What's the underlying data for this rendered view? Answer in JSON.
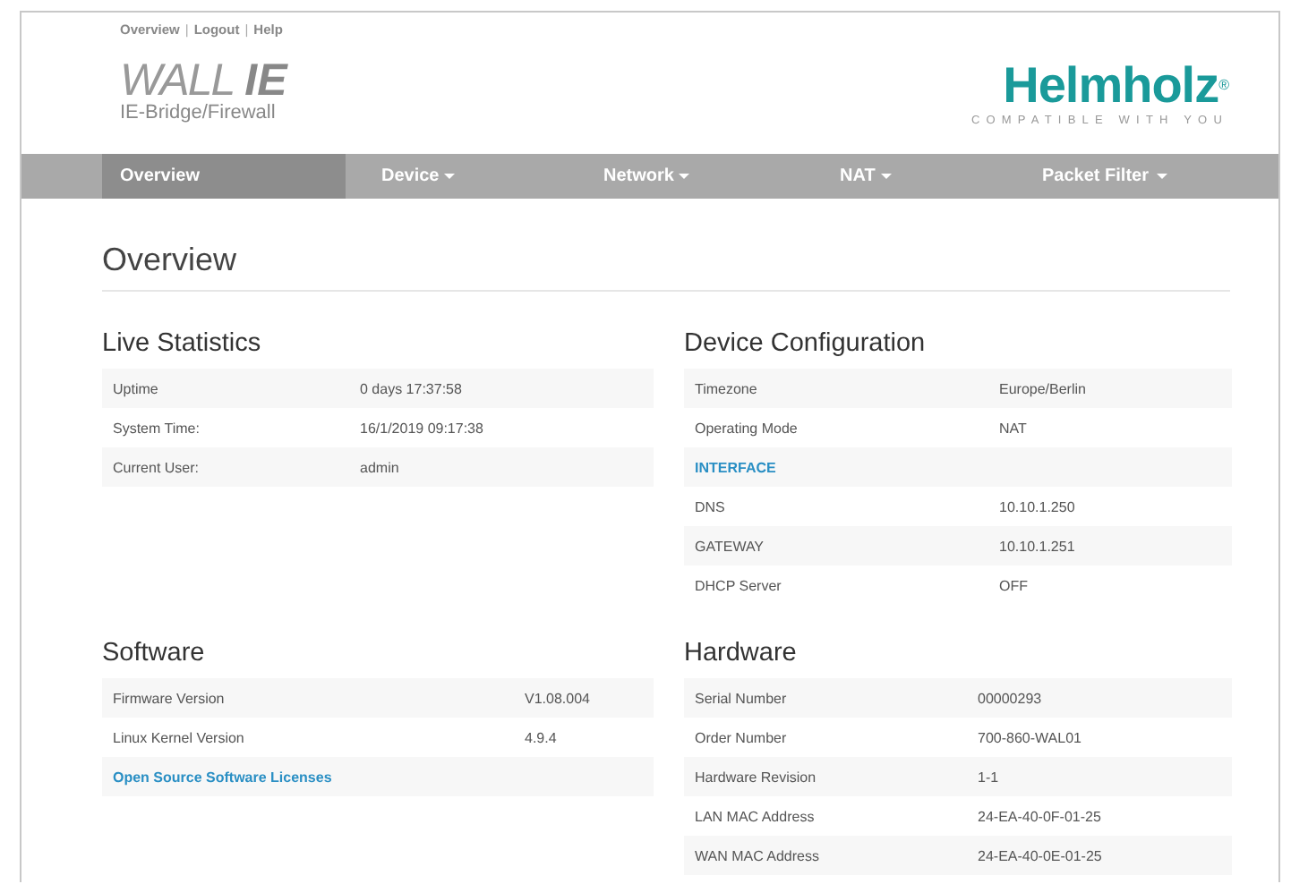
{
  "top_links": [
    {
      "label": "Overview"
    },
    {
      "label": "|",
      "kind": "separator"
    },
    {
      "label": "Logout"
    },
    {
      "label": "|",
      "kind": "separator"
    },
    {
      "label": "Help"
    }
  ],
  "product": {
    "name_light": "WALL",
    "name_bold": "IE",
    "subtitle": "IE-Bridge/Firewall"
  },
  "brand": {
    "name": "Helmholz$^{®}$",
    "tagline": "COMPATIBLE WITH YOU"
  },
  "nav": [
    {
      "label": "Overview",
      "selected": true,
      "dropdown": false
    },
    {
      "label": "Device",
      "selected": false,
      "dropdown": true
    },
    {
      "label": "Network",
      "selected": false,
      "dropdown": true
    },
    {
      "label": "NAT",
      "selected": false,
      "dropdown": true
    },
    {
      "label": "Packet Filter",
      "selected": false,
      "dropdown": true
    }
  ],
  "page_title": "Overview",
  "sections": [
    {
      "title": "Live Statistics",
      "rows": [
        {
          "kind": "pair",
          "label": "Uptime",
          "value": "0 days 17:37:58"
        },
        {
          "kind": "pair",
          "label": "System Time:",
          "value": "16/1/2019 09:17:38"
        },
        {
          "kind": "pair",
          "label": "Current User:",
          "value": "admin"
        }
      ]
    },
    {
      "title": "Device Configuration",
      "rows": [
        {
          "kind": "pair",
          "label": "Timezone",
          "value": "Europe/Berlin"
        },
        {
          "kind": "pair",
          "label": "Operating Mode",
          "value": "NAT"
        },
        {
          "kind": "heading",
          "label": "INTERFACE"
        },
        {
          "kind": "pair",
          "label": "DNS",
          "value": "10.10.1.250"
        },
        {
          "kind": "pair",
          "label": "GATEWAY",
          "value": "10.10.1.251"
        },
        {
          "kind": "pair",
          "label": "DHCP Server",
          "value": "OFF"
        }
      ]
    },
    {
      "title": "Software",
      "rows": [
        {
          "kind": "pair",
          "label": "Firmware Version",
          "value": "V1.08.004"
        },
        {
          "kind": "pair",
          "label": "Linux Kernel Version",
          "value": "4.9.4"
        },
        {
          "kind": "link",
          "label": "Open Source Software Licenses"
        }
      ]
    },
    {
      "title": "Hardware",
      "rows": [
        {
          "kind": "pair",
          "label": "Serial Number",
          "value": "00000293"
        },
        {
          "kind": "pair",
          "label": "Order Number",
          "value": "700-860-WAL01"
        },
        {
          "kind": "pair",
          "label": "Hardware Revision",
          "value": "1-1"
        },
        {
          "kind": "pair",
          "label": "LAN MAC Address",
          "value": "24-EA-40-0F-01-25"
        },
        {
          "kind": "pair",
          "label": "WAN MAC Address",
          "value": "24-EA-40-0E-01-25"
        }
      ]
    }
  ]
}
